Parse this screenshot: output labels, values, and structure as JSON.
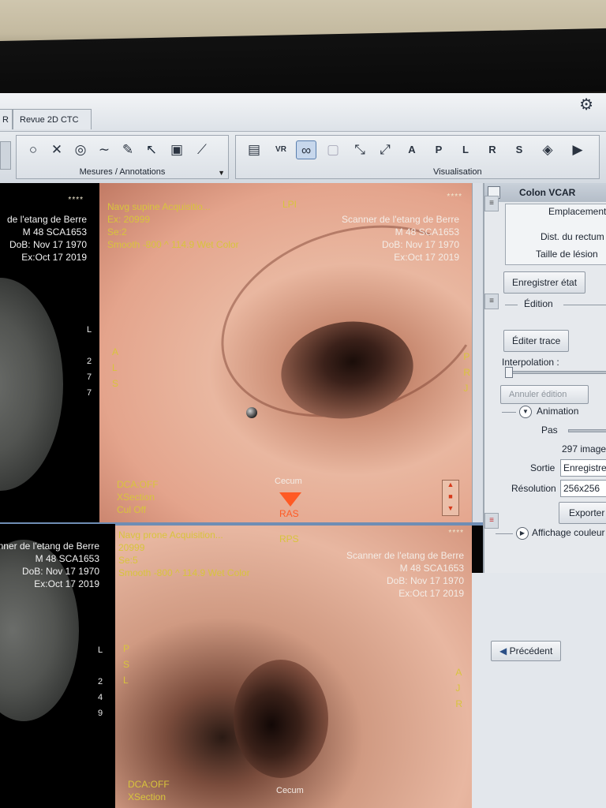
{
  "tabs": {
    "left_partial": "R",
    "main": "Revue 2D CTC"
  },
  "toolbar": {
    "group_measures_label": "Mesures / Annotations",
    "group_visual_label": "Visualisation",
    "vr_label": "VR",
    "a_label": "A",
    "p_label": "P",
    "l_label": "L",
    "r_label": "R",
    "s_label": "S"
  },
  "ct_top": {
    "stars": "****",
    "lines": [
      "de l'etang de Berre",
      "M 48 SCA1653",
      "DoB: Nov 17 1970",
      "Ex:Oct 17 2019"
    ],
    "side": [
      "L",
      "",
      "2",
      "7",
      "7"
    ]
  },
  "ct_bottom": {
    "lines": [
      "Scanner de l'etang de Berre",
      "M 48 SCA1653",
      "DoB: Nov 17 1970",
      "Ex:Oct 17 2019"
    ],
    "side": [
      "L",
      "",
      "2",
      "4",
      "9"
    ]
  },
  "endo_top": {
    "info": [
      "Navg supine Acquisitio...",
      "Ex: 20999",
      "Se:2",
      "Smooth -800 ^  114.9  Wet Color"
    ],
    "orientation": "LPI",
    "stars": "****",
    "patient": [
      "Scanner de l'etang de Berre",
      "M 48 SCA1653",
      "DoB: Nov 17 1970",
      "Ex:Oct 17 2019"
    ],
    "left_letters": [
      "A",
      "L",
      "S"
    ],
    "right_letters": [
      "P",
      "R",
      "J"
    ],
    "bottom_info": [
      "DCA:OFF",
      "XSection",
      "Cul Off"
    ],
    "cecum": "Cecum",
    "direction": "RAS"
  },
  "endo_bottom": {
    "info": [
      "Navg prone Acquisition...",
      "20999",
      "Se:5",
      "Smooth -800 ^  114.9  Wet Color"
    ],
    "orientation": "RPS",
    "stars": "****",
    "patient": [
      "Scanner de l'etang de Berre",
      "M 48 SCA1653",
      "DoB: Nov 17 1970",
      "Ex:Oct 17 2019"
    ],
    "left_letters": [
      "P",
      "S",
      "L"
    ],
    "right_letters": [
      "A",
      "J",
      "R"
    ],
    "bottom_info": [
      "DCA:OFF",
      "XSection"
    ],
    "cecum": "Cecum"
  },
  "panel": {
    "title": "Colon VCAR",
    "emplacement": "Emplacement",
    "dist_label": "Dist. du rectum",
    "taille_label": "Taille de lésion",
    "save_state": "Enregistrer état",
    "edition": "Édition",
    "edit_trace": "Éditer trace",
    "interpolation": "Interpolation :",
    "cancel_edit": "Annuler édition",
    "animation": "Animation",
    "pas": "Pas",
    "images": "297 image",
    "sortie_label": "Sortie",
    "sortie_value": "Enregistre",
    "resolution_label": "Résolution",
    "resolution_value": "256x256",
    "export": "Exporter",
    "affichage": "Affichage couleur",
    "previous": "Précédent"
  }
}
